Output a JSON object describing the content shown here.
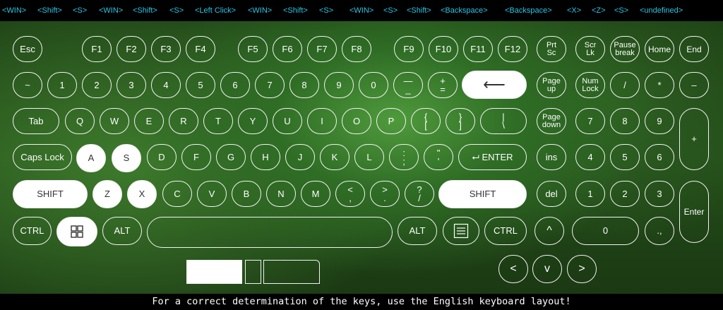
{
  "log": [
    "<WIN>",
    "<Shift>",
    "<S>",
    "<WIN>",
    "<Shift>",
    "<S>",
    "<Left Click>",
    "<WIN>",
    "<Shift>",
    "<S>",
    "<WIN>",
    "<S>",
    "<Shift>",
    "<Backspace>",
    "<Backspace>",
    "<X>",
    "<Z>",
    "<S>",
    "<undefined>"
  ],
  "keys": {
    "esc": "Esc",
    "f1": "F1",
    "f2": "F2",
    "f3": "F3",
    "f4": "F4",
    "f5": "F5",
    "f6": "F6",
    "f7": "F7",
    "f8": "F8",
    "f9": "F9",
    "f10": "F10",
    "f11": "F11",
    "f12": "F12",
    "prtsc_1": "Prt",
    "prtsc_2": "Sc",
    "scrlk_1": "Scr",
    "scrlk_2": "Lk",
    "pause_1": "Pause",
    "pause_2": "break",
    "home": "Home",
    "end": "End",
    "tilde": "~",
    "k1": "1",
    "k2": "2",
    "k3": "3",
    "k4": "4",
    "k5": "5",
    "k6": "6",
    "k7": "7",
    "k8": "8",
    "k9": "9",
    "k0": "0",
    "minus_1": "—",
    "minus_2": "_",
    "plus_1": "+",
    "plus_2": "=",
    "backspace": "⟵",
    "pgup_1": "Page",
    "pgup_2": "up",
    "numlock_1": "Num",
    "numlock_2": "Lock",
    "np_slash": "/",
    "np_star": "*",
    "np_minus": "–",
    "tab": "Tab",
    "q": "Q",
    "w": "W",
    "e": "E",
    "r": "R",
    "t": "T",
    "y": "Y",
    "u": "U",
    "i": "I",
    "o": "O",
    "p": "P",
    "lbr_1": "{",
    "lbr_2": "[",
    "rbr_1": "}",
    "rbr_2": "]",
    "bs_1": "|",
    "bs_2": "\\",
    "pgdn_1": "Page",
    "pgdn_2": "down",
    "np7": "7",
    "np8": "8",
    "np9": "9",
    "np_plus": "+",
    "caps": "Caps Lock",
    "a": "A",
    "s": "S",
    "d": "D",
    "f": "F",
    "g": "G",
    "h": "H",
    "j": "J",
    "k": "K",
    "l": "L",
    "semi_1": ":",
    "semi_2": ";",
    "quote_1": "\"",
    "quote_2": "'",
    "enter": "⮠ ENTER",
    "ins": "ins",
    "np4": "4",
    "np5": "5",
    "np6": "6",
    "lshift": "SHIFT",
    "z": "Z",
    "x": "X",
    "c": "C",
    "v": "V",
    "b": "B",
    "n": "N",
    "m": "M",
    "comma_1": "<",
    "comma_2": ",",
    "period_1": ">",
    "period_2": ".",
    "slash_1": "?",
    "slash_2": "/",
    "rshift": "SHIFT",
    "del": "del",
    "np1": "1",
    "np2": "2",
    "np3": "3",
    "np_enter": "Enter",
    "lctrl": "CTRL",
    "lalt": "ALT",
    "ralt": "ALT",
    "rctrl": "CTRL",
    "up": "^",
    "np0": "0",
    "np_dot": ".,",
    "left": "<",
    "down": "v",
    "right": ">"
  },
  "footer": "For a correct determination of the keys, use the English keyboard layout!"
}
